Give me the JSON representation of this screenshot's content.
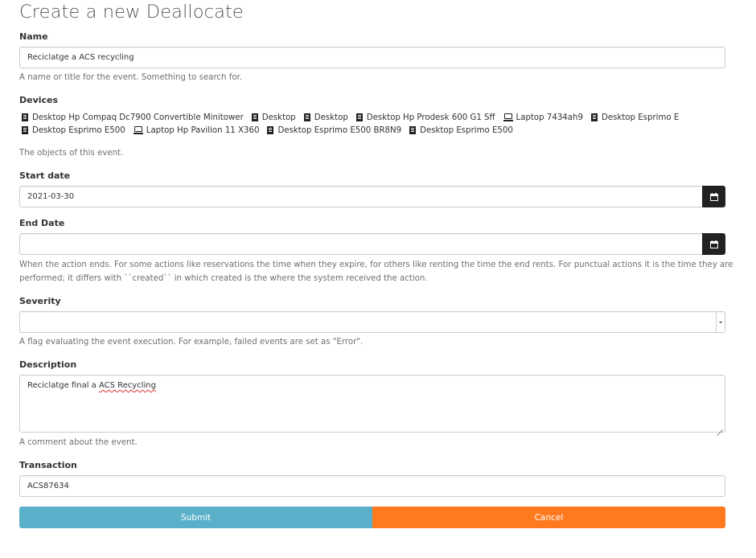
{
  "page": {
    "title": "Create a new Deallocate"
  },
  "name": {
    "label": "Name",
    "value": "Reciclatge a ACS recycling",
    "help": "A name or title for the event. Something to search for."
  },
  "devices": {
    "label": "Devices",
    "row1": [
      {
        "icon": "desktop-icon",
        "label": "Desktop Hp Compaq Dc7900 Convertible Minitower"
      },
      {
        "icon": "desktop-icon",
        "label": "Desktop"
      },
      {
        "icon": "desktop-icon",
        "label": "Desktop"
      },
      {
        "icon": "desktop-icon",
        "label": "Desktop Hp Prodesk 600 G1 Sff"
      },
      {
        "icon": "laptop-icon",
        "label": "Laptop 7434ah9"
      },
      {
        "icon": "desktop-icon",
        "label": "Desktop Esprimo E"
      }
    ],
    "row2": [
      {
        "icon": "desktop-icon",
        "label": "Desktop Esprimo E500"
      },
      {
        "icon": "laptop-icon",
        "label": "Laptop Hp Pavilion 11 X360"
      },
      {
        "icon": "desktop-icon",
        "label": "Desktop Esprimo E500 BR8N9"
      },
      {
        "icon": "desktop-icon",
        "label": "Desktop Esprimo E500"
      }
    ],
    "help": "The objects of this event."
  },
  "start_date": {
    "label": "Start date",
    "value": "2021-03-30",
    "icon": "calendar-icon"
  },
  "end_date": {
    "label": "End Date",
    "value": "",
    "icon": "calendar-icon",
    "help_line1": "When the action ends. For some actions like reservations the time when they expire, for others like renting the time the end rents. For punctual actions it is the time they are",
    "help_line2": "performed; it differs with ``created`` in which created is the where the system received the action."
  },
  "severity": {
    "label": "Severity",
    "value": "",
    "help": "A flag evaluating the event execution. For example, failed events are set as \"Error\"."
  },
  "description": {
    "label": "Description",
    "value_prefix": "Reciclatge final a ",
    "value_underlined": "ACS Recycling",
    "help": "A comment about the event."
  },
  "transaction": {
    "label": "Transaction",
    "value": "ACS87634"
  },
  "buttons": {
    "submit": "Submit",
    "cancel": "Cancel"
  },
  "colors": {
    "submit": "#5bb0c9",
    "cancel": "#ff7a1f",
    "addon": "#222222"
  }
}
